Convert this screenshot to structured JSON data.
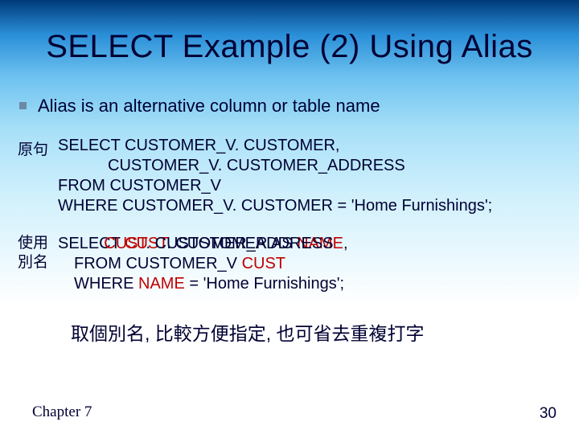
{
  "title": "SELECT Example (2) Using Alias",
  "bullet": "Alias is an alternative column or table name",
  "block1": {
    "label": "原句",
    "line1": "SELECT CUSTOMER_V. CUSTOMER,",
    "line2": "CUSTOMER_V. CUSTOMER_ADDRESS",
    "line3": "FROM CUSTOMER_V",
    "line4": "WHERE CUSTOMER_V. CUSTOMER = 'Home Furnishings';"
  },
  "block2": {
    "label1": "使用",
    "label2": "別名",
    "line1_a": "SELECT ",
    "line1_b": "CUST",
    "line1_c": ". CUSTOMER AS ",
    "line1_d": "NAME",
    "line1_e": ",",
    "line1_ext_a": "CUST",
    "line1_ext_b": ". CUSTOMER_ADDRESS",
    "line2_a": "FROM CUSTOMER_V ",
    "line2_b": "CUST",
    "line3_a": "WHERE ",
    "line3_b": "NAME",
    "line3_c": " = 'Home Furnishings';"
  },
  "note": "取個別名, 比較方便指定, 也可省去重複打字",
  "chapter": "Chapter 7",
  "page": "30"
}
